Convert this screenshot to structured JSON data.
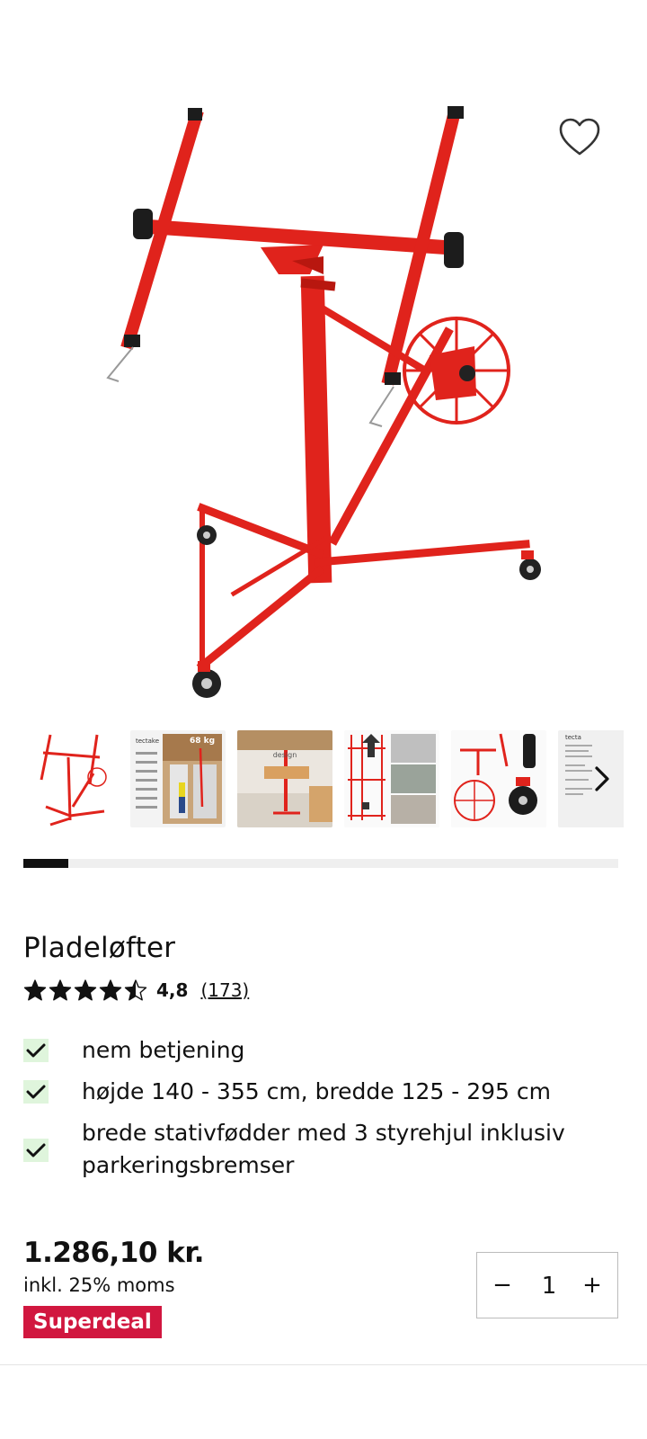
{
  "product": {
    "title": "Pladeløfter",
    "rating_value": "4,8",
    "rating_stars": 4.5,
    "rating_count": "(173)",
    "features": [
      "nem betjening",
      "højde 140 - 355 cm, bredde 125 - 295 cm",
      "brede stativfødder med 3 styrehjul inklusiv parkeringsbremser"
    ],
    "price": "1.286,10 kr.",
    "vat_note": "inkl. 25% moms",
    "badge": "Superdeal",
    "badge_color": "#d1173f",
    "quantity": "1"
  },
  "gallery": {
    "thumbnails": [
      "thumb-lift-red",
      "thumb-room-68kg",
      "thumb-design",
      "thumb-height-arrows",
      "thumb-details-wheels",
      "thumb-specs"
    ],
    "thumb_texts": [
      "tectake",
      "68 kg",
      "design",
      "tecta"
    ],
    "progress": 0.075,
    "favorite_icon": "heart-outline-icon",
    "next_icon": "chevron-right-icon"
  },
  "icons": {
    "check": "check-icon",
    "star": "star-icon",
    "minus": "minus-icon",
    "plus": "plus-icon"
  },
  "colors": {
    "product_red": "#e0231c",
    "check_bg": "#dff5dc",
    "text": "#111111"
  }
}
